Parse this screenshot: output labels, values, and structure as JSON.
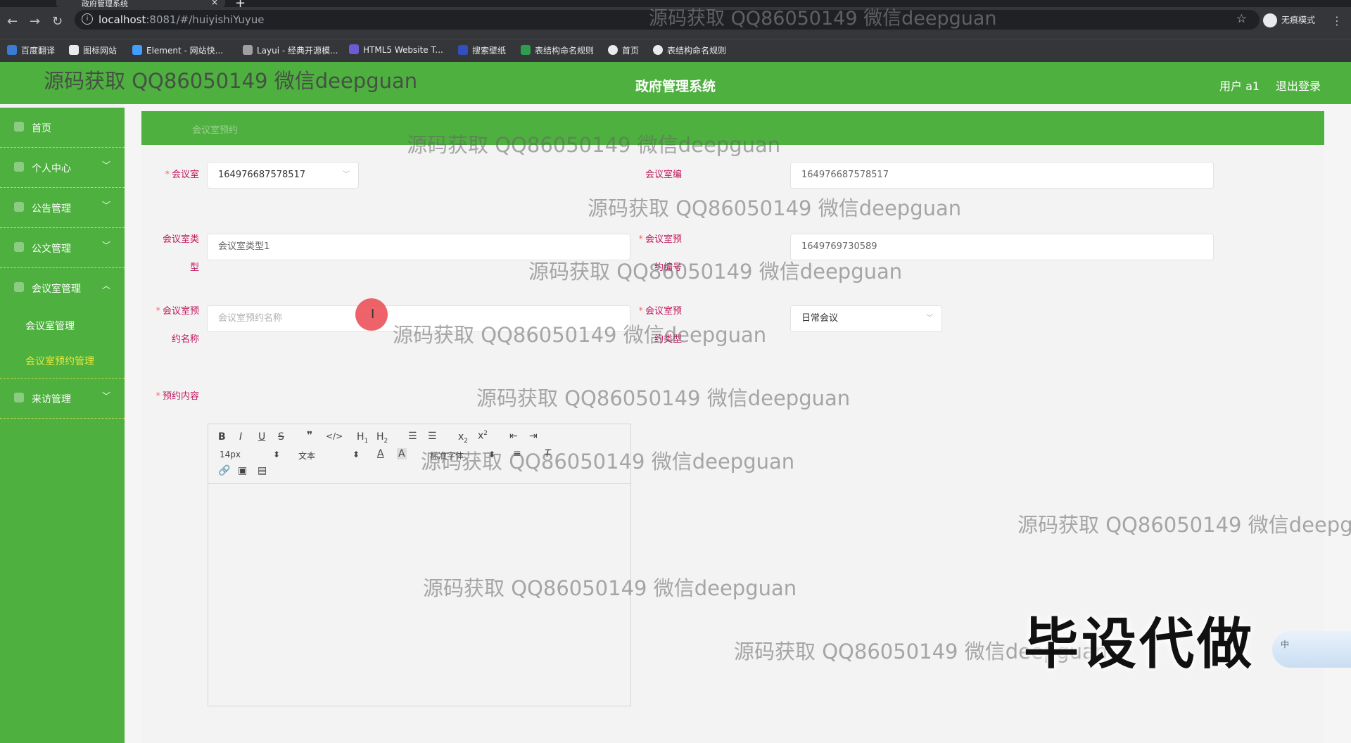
{
  "browser": {
    "tab_title": "政府管理系统",
    "url_host": "localhost",
    "url_rest": ":8081/#/huiyishiYuyue",
    "incognito_label": "无痕模式",
    "bookmarks": [
      "百度翻译",
      "图标网站",
      "Element - 网站快...",
      "Layui - 经典开源模...",
      "HTML5 Website T...",
      "搜索壁纸",
      "表结构命名规则",
      "首页",
      "表结构命名规则"
    ]
  },
  "header": {
    "title": "政府管理系统",
    "user": "用户 a1",
    "logout": "退出登录"
  },
  "sidebar": {
    "items": [
      {
        "label": "首页",
        "arrow": ""
      },
      {
        "label": "个人中心",
        "arrow": "﹀"
      },
      {
        "label": "公告管理",
        "arrow": "﹀"
      },
      {
        "label": "公文管理",
        "arrow": "﹀"
      },
      {
        "label": "会议室管理",
        "arrow": "︿"
      }
    ],
    "sub_items": [
      "会议室管理",
      "会议室预约管理"
    ],
    "last_item": {
      "label": "来访管理",
      "arrow": "﹀"
    }
  },
  "banner": {
    "crumb": "会议室预约"
  },
  "form": {
    "room_label": "会议室",
    "room_value": "1649766875785​17",
    "room_no_label": "会议室编",
    "room_no_value": "164976687578517",
    "room_type_label_1": "会议室类",
    "room_type_label_2": "型",
    "room_type_value": "会议室类型1",
    "booking_no_label_1": "会议室预",
    "booking_no_label_2": "约编号",
    "booking_no_value": "1649769730589",
    "booking_name_label_1": "会议室预",
    "booking_name_label_2": "约名称",
    "booking_name_placeholder": "会议室预约名称",
    "booking_type_label_1": "会议室预",
    "booking_type_label_2": "约类型",
    "booking_type_value": "日常会议",
    "content_label": "预约内容",
    "editor": {
      "font_size": "14px",
      "text_style": "文本",
      "font_family": "标准字体"
    }
  },
  "overlays": {
    "watermark": "源码获取 QQ86050149 微信deepguan",
    "watermark_top": "源码获取 QQ86050149 微信deepguan",
    "watermark_cut": "源码获取 QQ86050149 微信deepg",
    "big_tag": "毕设代做",
    "ime": "中"
  }
}
